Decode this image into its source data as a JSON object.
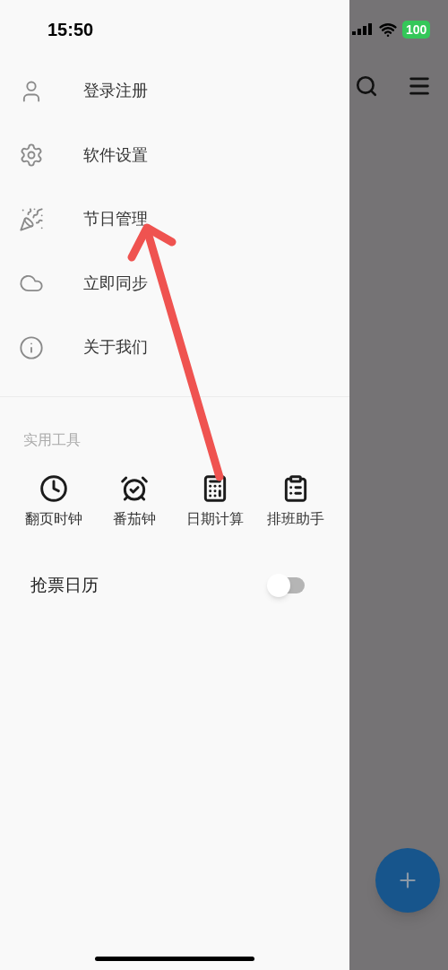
{
  "status_bar": {
    "time": "15:50",
    "battery": "100"
  },
  "drawer": {
    "menu": [
      {
        "label": "登录注册"
      },
      {
        "label": "软件设置"
      },
      {
        "label": "节日管理"
      },
      {
        "label": "立即同步"
      },
      {
        "label": "关于我们"
      }
    ],
    "tools_title": "实用工具",
    "tools": [
      {
        "label": "翻页时钟"
      },
      {
        "label": "番茄钟"
      },
      {
        "label": "日期计算"
      },
      {
        "label": "排班助手"
      }
    ],
    "toggle": {
      "label": "抢票日历",
      "on": false
    }
  }
}
